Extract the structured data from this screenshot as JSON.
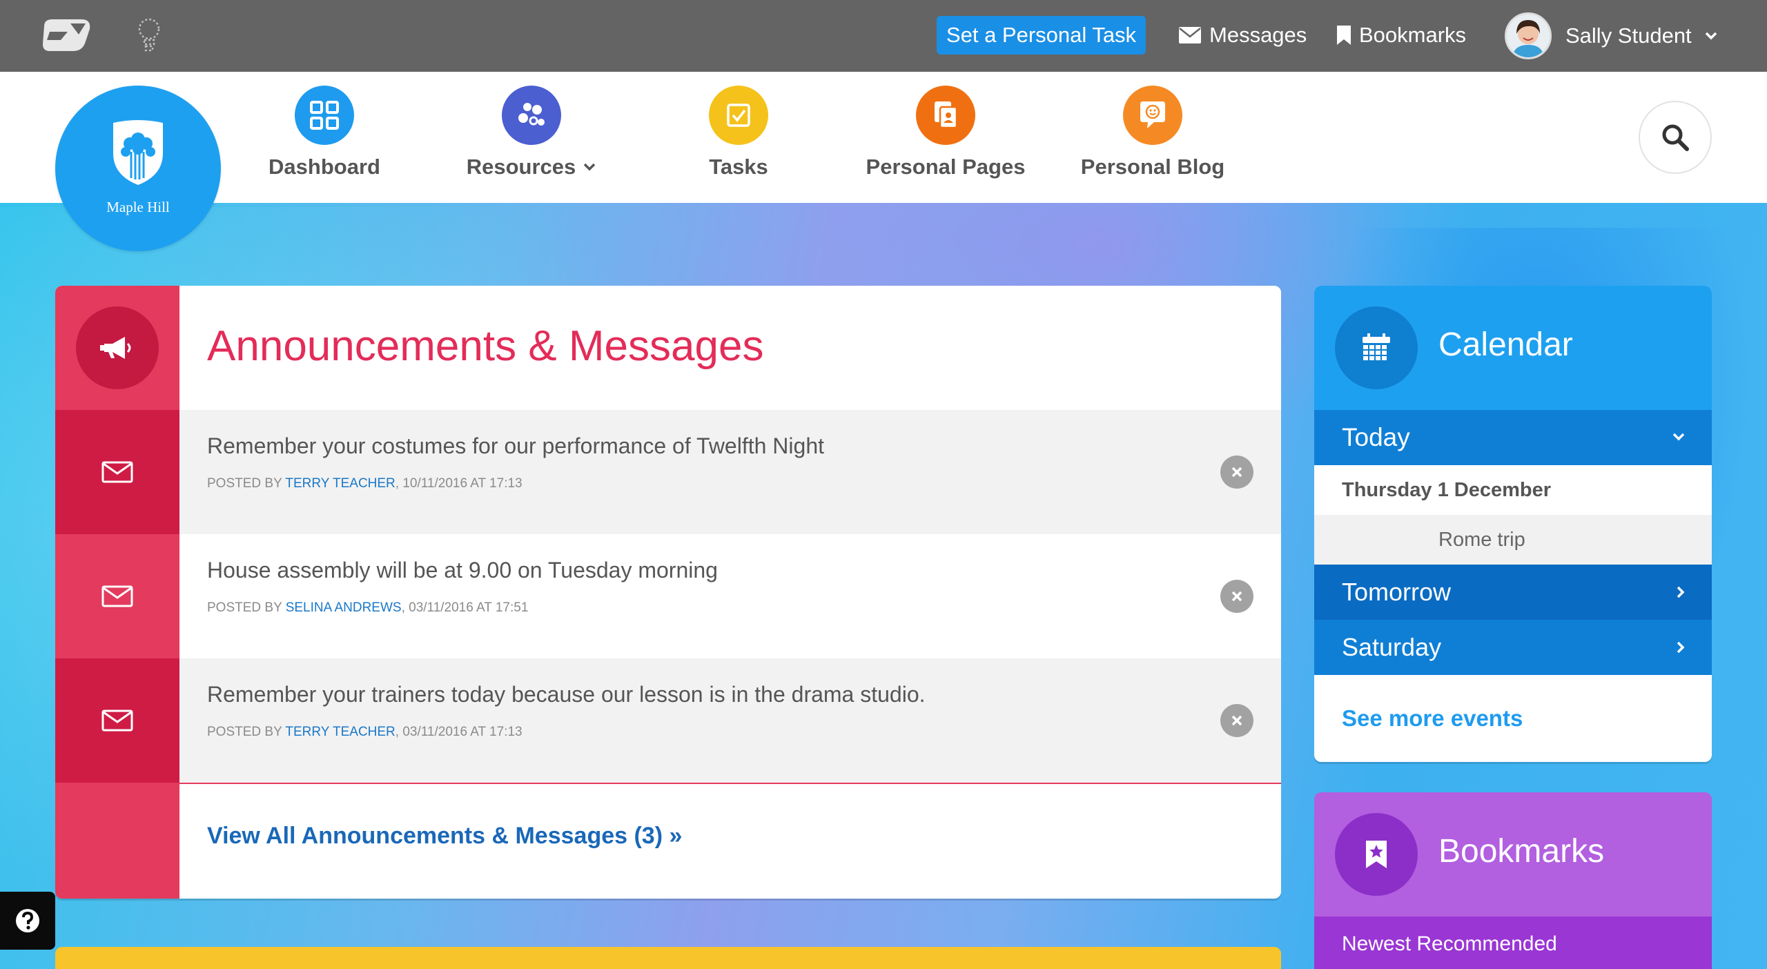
{
  "topbar": {
    "task_button": "Set a Personal Task",
    "messages": "Messages",
    "bookmarks": "Bookmarks",
    "user_name": "Sally Student"
  },
  "school": {
    "name": "Maple Hill"
  },
  "nav": {
    "items": [
      {
        "label": "Dashboard",
        "icon": "dashboard-grid-icon",
        "color": "#1e9bef"
      },
      {
        "label": "Resources",
        "icon": "resources-icon",
        "color": "#4b5fd0"
      },
      {
        "label": "Tasks",
        "icon": "tasks-check-icon",
        "color": "#f5c21b"
      },
      {
        "label": "Personal Pages",
        "icon": "personal-pages-icon",
        "color": "#f07011"
      },
      {
        "label": "Personal Blog",
        "icon": "personal-blog-icon",
        "color": "#f58a24"
      }
    ]
  },
  "announcements": {
    "title": "Announcements & Messages",
    "messages": [
      {
        "text": "Remember your costumes for our performance of Twelfth Night",
        "posted_by": "POSTED BY ",
        "author": "TERRY TEACHER",
        "date": ", 10/11/2016 AT 17:13"
      },
      {
        "text": "House assembly will be at 9.00 on Tuesday morning",
        "posted_by": "POSTED BY ",
        "author": "SELINA ANDREWS",
        "date": ", 03/11/2016 AT 17:51"
      },
      {
        "text": "Remember your trainers today because our lesson is in the drama studio.",
        "posted_by": "POSTED BY ",
        "author": "TERRY TEACHER",
        "date": ", 03/11/2016 AT 17:13"
      }
    ],
    "view_all": "View All Announcements & Messages (3) »"
  },
  "calendar": {
    "title": "Calendar",
    "today": "Today",
    "date": "Thursday 1 December",
    "event": "Rome trip",
    "tomorrow": "Tomorrow",
    "saturday": "Saturday",
    "see_more": "See more events"
  },
  "bookmarks_panel": {
    "title": "Bookmarks",
    "tab": "Newest Recommended"
  },
  "colors": {
    "topbar": "#646464",
    "accent_blue": "#1e9bef",
    "announcement_red": "#e33a5d",
    "bookmark_purple": "#b25fe0"
  }
}
